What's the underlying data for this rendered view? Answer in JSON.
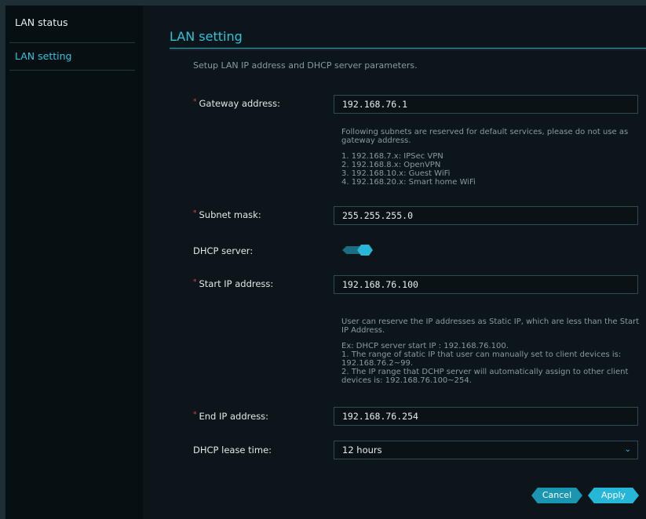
{
  "sidebar": {
    "items": [
      {
        "label": "LAN status"
      },
      {
        "label": "LAN setting"
      }
    ]
  },
  "page": {
    "title": "LAN setting",
    "description": "Setup LAN IP address and DHCP server parameters."
  },
  "form": {
    "required_mark": "*",
    "gateway": {
      "label": "Gateway address:",
      "value": "192.168.76.1"
    },
    "gateway_note": {
      "text": "Following subnets are reserved for default services, please do not use as gateway address.",
      "list": [
        "1. 192.168.7.x: IPSec VPN",
        "2. 192.168.8.x: OpenVPN",
        "3. 192.168.10.x: Guest WiFi",
        "4. 192.168.20.x: Smart home WiFi"
      ]
    },
    "subnet": {
      "label": "Subnet mask:",
      "value": "255.255.255.0"
    },
    "dhcp": {
      "label": "DHCP server:",
      "enabled": true
    },
    "start_ip": {
      "label": "Start IP address:",
      "value": "192.168.76.100"
    },
    "start_note": {
      "text": "User can reserve the IP addresses as Static IP, which are less than the Start IP Address.",
      "lines": [
        "Ex: DHCP server start IP : 192.168.76.100.",
        "1. The range of static IP that user can manually set to client devices is: 192.168.76.2~99.",
        "2. The IP range that DCHP server will automatically assign to other client devices is: 192.168.76.100~254."
      ]
    },
    "end_ip": {
      "label": "End IP address:",
      "value": "192.168.76.254"
    },
    "lease": {
      "label": "DHCP lease time:",
      "value": "12 hours",
      "icon": "chevron-down-icon"
    }
  },
  "buttons": {
    "cancel": "Cancel",
    "apply": "Apply"
  },
  "colors": {
    "accent": "#2fc3de",
    "background": "#0c1519",
    "required": "#e0454b"
  }
}
